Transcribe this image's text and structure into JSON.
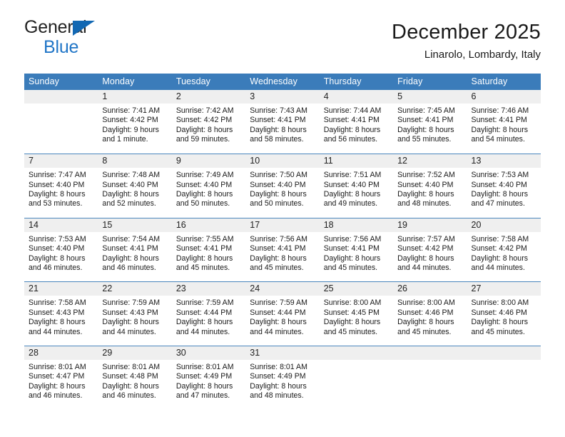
{
  "logo": {
    "line1": "General",
    "line2": "Blue",
    "triangle_color": "#1268b3",
    "blue_color": "#2176c7"
  },
  "header": {
    "title": "December 2025",
    "subtitle": "Linarolo, Lombardy, Italy"
  },
  "theme": {
    "header_bg": "#3b7cba",
    "daynum_bg": "#efefef",
    "row_line": "#4a86bd"
  },
  "weekday_headers": [
    "Sunday",
    "Monday",
    "Tuesday",
    "Wednesday",
    "Thursday",
    "Friday",
    "Saturday"
  ],
  "weeks": [
    [
      {
        "day": "",
        "lines": []
      },
      {
        "day": "1",
        "lines": [
          "Sunrise: 7:41 AM",
          "Sunset: 4:42 PM",
          "Daylight: 9 hours",
          "and 1 minute."
        ]
      },
      {
        "day": "2",
        "lines": [
          "Sunrise: 7:42 AM",
          "Sunset: 4:42 PM",
          "Daylight: 8 hours",
          "and 59 minutes."
        ]
      },
      {
        "day": "3",
        "lines": [
          "Sunrise: 7:43 AM",
          "Sunset: 4:41 PM",
          "Daylight: 8 hours",
          "and 58 minutes."
        ]
      },
      {
        "day": "4",
        "lines": [
          "Sunrise: 7:44 AM",
          "Sunset: 4:41 PM",
          "Daylight: 8 hours",
          "and 56 minutes."
        ]
      },
      {
        "day": "5",
        "lines": [
          "Sunrise: 7:45 AM",
          "Sunset: 4:41 PM",
          "Daylight: 8 hours",
          "and 55 minutes."
        ]
      },
      {
        "day": "6",
        "lines": [
          "Sunrise: 7:46 AM",
          "Sunset: 4:41 PM",
          "Daylight: 8 hours",
          "and 54 minutes."
        ]
      }
    ],
    [
      {
        "day": "7",
        "lines": [
          "Sunrise: 7:47 AM",
          "Sunset: 4:40 PM",
          "Daylight: 8 hours",
          "and 53 minutes."
        ]
      },
      {
        "day": "8",
        "lines": [
          "Sunrise: 7:48 AM",
          "Sunset: 4:40 PM",
          "Daylight: 8 hours",
          "and 52 minutes."
        ]
      },
      {
        "day": "9",
        "lines": [
          "Sunrise: 7:49 AM",
          "Sunset: 4:40 PM",
          "Daylight: 8 hours",
          "and 50 minutes."
        ]
      },
      {
        "day": "10",
        "lines": [
          "Sunrise: 7:50 AM",
          "Sunset: 4:40 PM",
          "Daylight: 8 hours",
          "and 50 minutes."
        ]
      },
      {
        "day": "11",
        "lines": [
          "Sunrise: 7:51 AM",
          "Sunset: 4:40 PM",
          "Daylight: 8 hours",
          "and 49 minutes."
        ]
      },
      {
        "day": "12",
        "lines": [
          "Sunrise: 7:52 AM",
          "Sunset: 4:40 PM",
          "Daylight: 8 hours",
          "and 48 minutes."
        ]
      },
      {
        "day": "13",
        "lines": [
          "Sunrise: 7:53 AM",
          "Sunset: 4:40 PM",
          "Daylight: 8 hours",
          "and 47 minutes."
        ]
      }
    ],
    [
      {
        "day": "14",
        "lines": [
          "Sunrise: 7:53 AM",
          "Sunset: 4:40 PM",
          "Daylight: 8 hours",
          "and 46 minutes."
        ]
      },
      {
        "day": "15",
        "lines": [
          "Sunrise: 7:54 AM",
          "Sunset: 4:41 PM",
          "Daylight: 8 hours",
          "and 46 minutes."
        ]
      },
      {
        "day": "16",
        "lines": [
          "Sunrise: 7:55 AM",
          "Sunset: 4:41 PM",
          "Daylight: 8 hours",
          "and 45 minutes."
        ]
      },
      {
        "day": "17",
        "lines": [
          "Sunrise: 7:56 AM",
          "Sunset: 4:41 PM",
          "Daylight: 8 hours",
          "and 45 minutes."
        ]
      },
      {
        "day": "18",
        "lines": [
          "Sunrise: 7:56 AM",
          "Sunset: 4:41 PM",
          "Daylight: 8 hours",
          "and 45 minutes."
        ]
      },
      {
        "day": "19",
        "lines": [
          "Sunrise: 7:57 AM",
          "Sunset: 4:42 PM",
          "Daylight: 8 hours",
          "and 44 minutes."
        ]
      },
      {
        "day": "20",
        "lines": [
          "Sunrise: 7:58 AM",
          "Sunset: 4:42 PM",
          "Daylight: 8 hours",
          "and 44 minutes."
        ]
      }
    ],
    [
      {
        "day": "21",
        "lines": [
          "Sunrise: 7:58 AM",
          "Sunset: 4:43 PM",
          "Daylight: 8 hours",
          "and 44 minutes."
        ]
      },
      {
        "day": "22",
        "lines": [
          "Sunrise: 7:59 AM",
          "Sunset: 4:43 PM",
          "Daylight: 8 hours",
          "and 44 minutes."
        ]
      },
      {
        "day": "23",
        "lines": [
          "Sunrise: 7:59 AM",
          "Sunset: 4:44 PM",
          "Daylight: 8 hours",
          "and 44 minutes."
        ]
      },
      {
        "day": "24",
        "lines": [
          "Sunrise: 7:59 AM",
          "Sunset: 4:44 PM",
          "Daylight: 8 hours",
          "and 44 minutes."
        ]
      },
      {
        "day": "25",
        "lines": [
          "Sunrise: 8:00 AM",
          "Sunset: 4:45 PM",
          "Daylight: 8 hours",
          "and 45 minutes."
        ]
      },
      {
        "day": "26",
        "lines": [
          "Sunrise: 8:00 AM",
          "Sunset: 4:46 PM",
          "Daylight: 8 hours",
          "and 45 minutes."
        ]
      },
      {
        "day": "27",
        "lines": [
          "Sunrise: 8:00 AM",
          "Sunset: 4:46 PM",
          "Daylight: 8 hours",
          "and 45 minutes."
        ]
      }
    ],
    [
      {
        "day": "28",
        "lines": [
          "Sunrise: 8:01 AM",
          "Sunset: 4:47 PM",
          "Daylight: 8 hours",
          "and 46 minutes."
        ]
      },
      {
        "day": "29",
        "lines": [
          "Sunrise: 8:01 AM",
          "Sunset: 4:48 PM",
          "Daylight: 8 hours",
          "and 46 minutes."
        ]
      },
      {
        "day": "30",
        "lines": [
          "Sunrise: 8:01 AM",
          "Sunset: 4:49 PM",
          "Daylight: 8 hours",
          "and 47 minutes."
        ]
      },
      {
        "day": "31",
        "lines": [
          "Sunrise: 8:01 AM",
          "Sunset: 4:49 PM",
          "Daylight: 8 hours",
          "and 48 minutes."
        ]
      },
      {
        "day": "",
        "lines": []
      },
      {
        "day": "",
        "lines": []
      },
      {
        "day": "",
        "lines": []
      }
    ]
  ]
}
